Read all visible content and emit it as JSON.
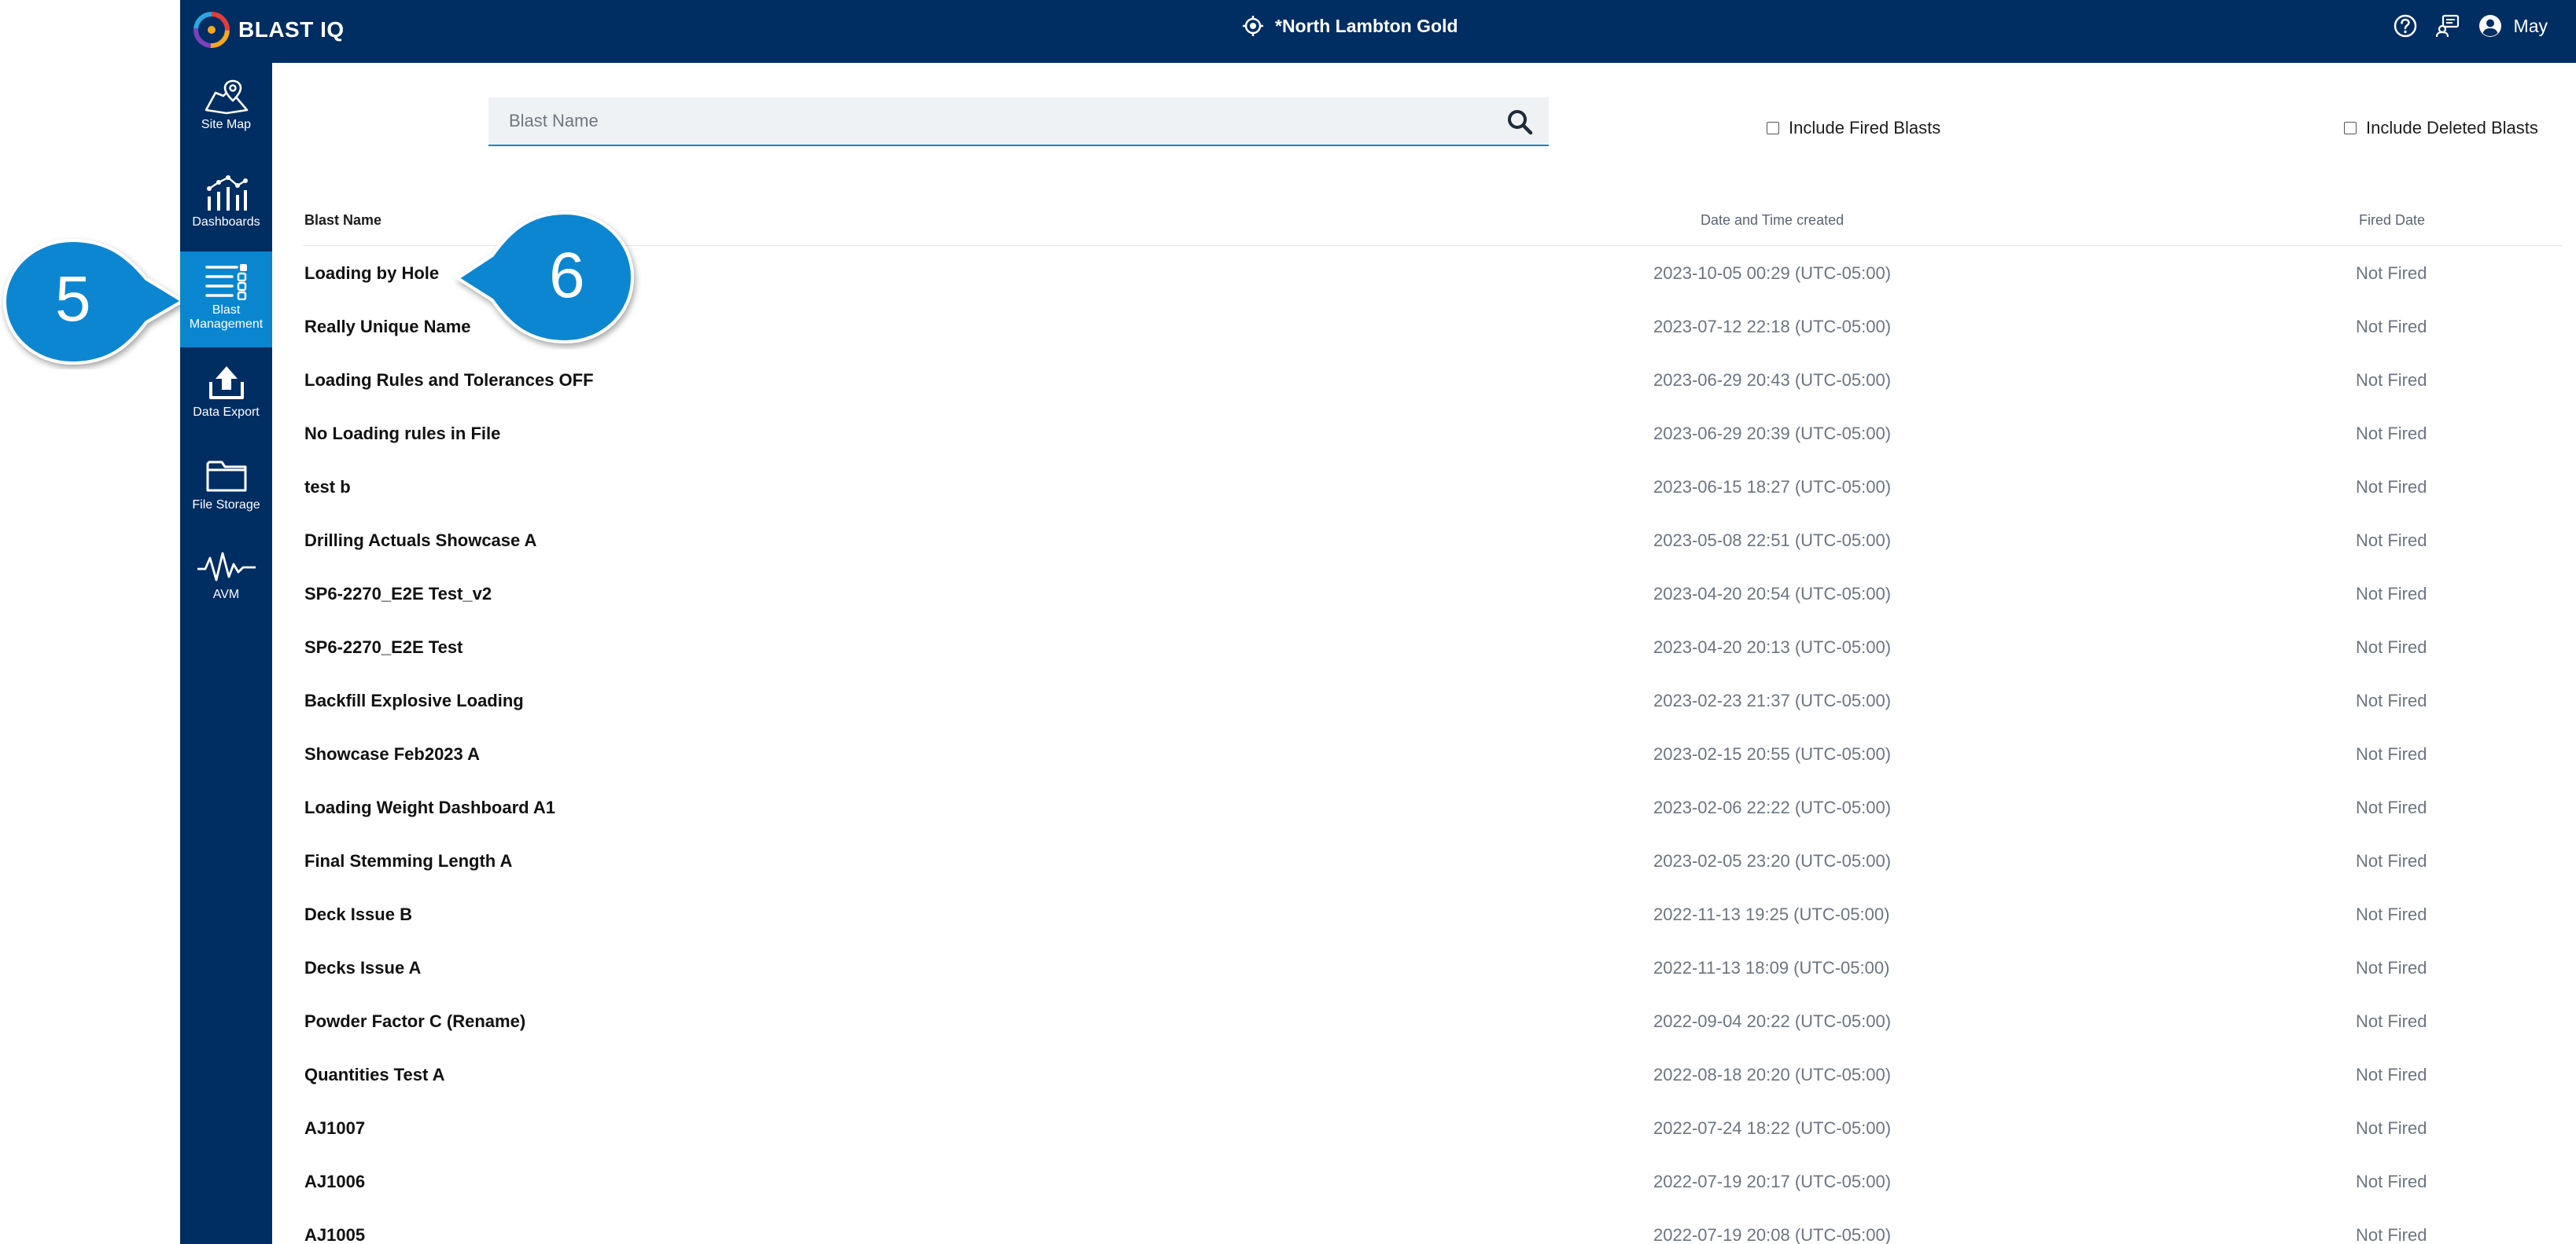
{
  "app": {
    "logo_text": "BLAST IQ"
  },
  "header": {
    "site_name": "*North Lambton Gold",
    "user_name": "May"
  },
  "sidebar": {
    "items": [
      {
        "label": "Site Map",
        "icon": "map-icon"
      },
      {
        "label": "Dashboards",
        "icon": "dashboard-icon"
      },
      {
        "label": "Blast Management",
        "icon": "list-settings-icon",
        "active": true
      },
      {
        "label": "Data Export",
        "icon": "upload-icon"
      },
      {
        "label": "File Storage",
        "icon": "folder-icon"
      },
      {
        "label": "AVM",
        "icon": "waveform-icon"
      }
    ]
  },
  "callouts": {
    "first": "5",
    "second": "6"
  },
  "search": {
    "placeholder": "Blast Name",
    "value": ""
  },
  "filters": {
    "include_fired": "Include Fired Blasts",
    "include_deleted": "Include Deleted Blasts"
  },
  "table": {
    "columns": {
      "name": "Blast Name",
      "date": "Date and Time created",
      "fired": "Fired Date"
    },
    "rows": [
      {
        "name": "Loading by Hole",
        "date": "2023-10-05 00:29 (UTC-05:00)",
        "fired": "Not Fired"
      },
      {
        "name": "Really Unique Name",
        "date": "2023-07-12 22:18 (UTC-05:00)",
        "fired": "Not Fired"
      },
      {
        "name": "Loading Rules and Tolerances OFF",
        "date": "2023-06-29 20:43 (UTC-05:00)",
        "fired": "Not Fired"
      },
      {
        "name": "No Loading rules in File",
        "date": "2023-06-29 20:39 (UTC-05:00)",
        "fired": "Not Fired"
      },
      {
        "name": "test b",
        "date": "2023-06-15 18:27 (UTC-05:00)",
        "fired": "Not Fired"
      },
      {
        "name": "Drilling Actuals Showcase A",
        "date": "2023-05-08 22:51 (UTC-05:00)",
        "fired": "Not Fired"
      },
      {
        "name": "SP6-2270_E2E Test_v2",
        "date": "2023-04-20 20:54 (UTC-05:00)",
        "fired": "Not Fired"
      },
      {
        "name": "SP6-2270_E2E Test",
        "date": "2023-04-20 20:13 (UTC-05:00)",
        "fired": "Not Fired"
      },
      {
        "name": "Backfill Explosive Loading",
        "date": "2023-02-23 21:37 (UTC-05:00)",
        "fired": "Not Fired"
      },
      {
        "name": "Showcase Feb2023 A",
        "date": "2023-02-15 20:55 (UTC-05:00)",
        "fired": "Not Fired"
      },
      {
        "name": "Loading Weight Dashboard A1",
        "date": "2023-02-06 22:22 (UTC-05:00)",
        "fired": "Not Fired"
      },
      {
        "name": "Final Stemming Length A",
        "date": "2023-02-05 23:20 (UTC-05:00)",
        "fired": "Not Fired"
      },
      {
        "name": "Deck Issue B",
        "date": "2022-11-13 19:25 (UTC-05:00)",
        "fired": "Not Fired"
      },
      {
        "name": "Decks Issue A",
        "date": "2022-11-13 18:09 (UTC-05:00)",
        "fired": "Not Fired"
      },
      {
        "name": "Powder Factor C (Rename)",
        "date": "2022-09-04 20:22 (UTC-05:00)",
        "fired": "Not Fired"
      },
      {
        "name": "Quantities Test A",
        "date": "2022-08-18 20:20 (UTC-05:00)",
        "fired": "Not Fired"
      },
      {
        "name": "AJ1007",
        "date": "2022-07-24 18:22 (UTC-05:00)",
        "fired": "Not Fired"
      },
      {
        "name": "AJ1006",
        "date": "2022-07-19 20:17 (UTC-05:00)",
        "fired": "Not Fired"
      },
      {
        "name": "AJ1005",
        "date": "2022-07-19 20:08 (UTC-05:00)",
        "fired": "Not Fired"
      }
    ]
  },
  "colors": {
    "navy": "#002d62",
    "accent": "#0a86d1",
    "callout": "#0a86d1"
  }
}
